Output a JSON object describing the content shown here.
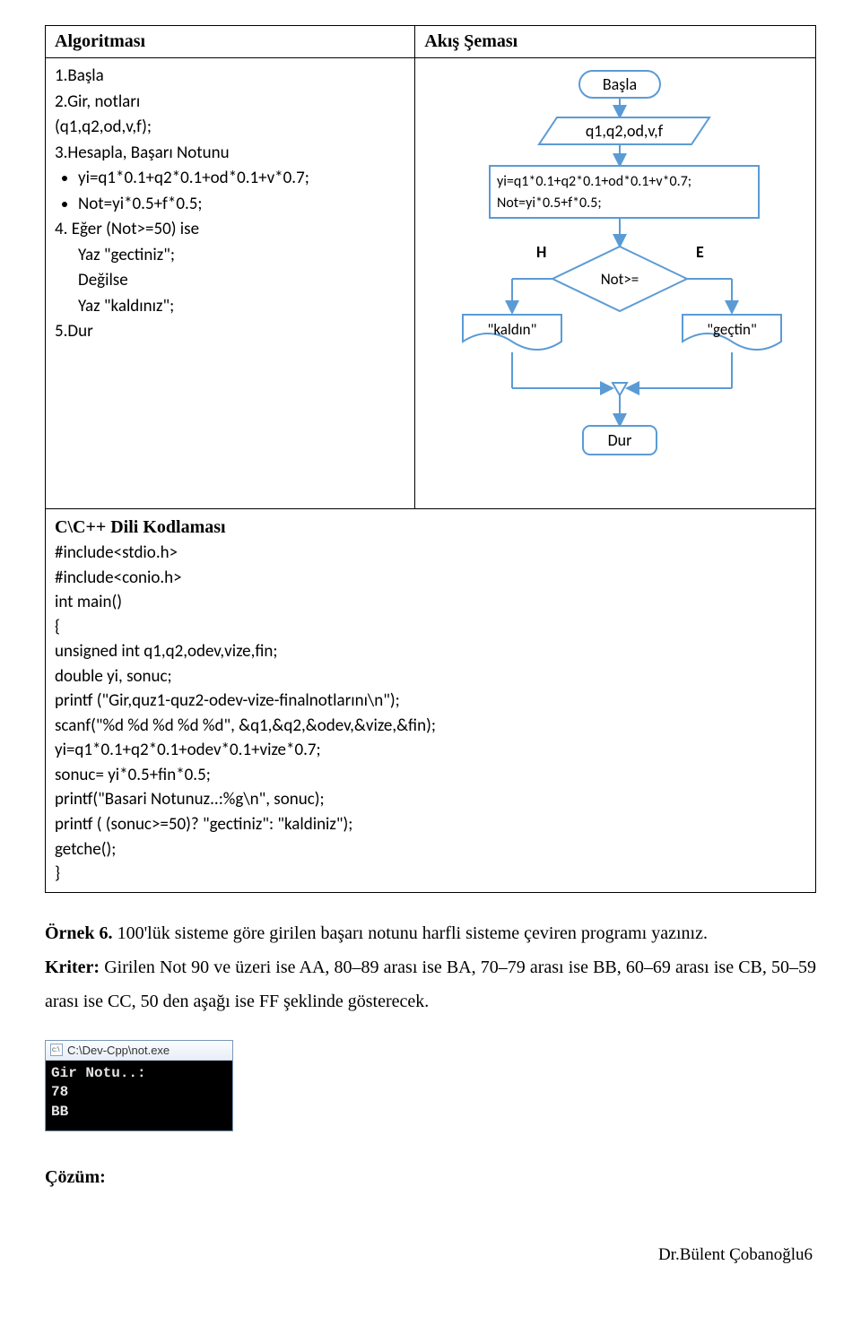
{
  "hdr_algo": "Algoritması",
  "hdr_flow": "Akış Şeması",
  "algo": {
    "l1": "1.Başla",
    "l2": "2.Gir, notları",
    "l2b": "(q1,q2,od,v,f);",
    "l3": "3.Hesapla, Başarı Notunu",
    "b1": "yi=q1*0.1+q2*0.1+od*0.1+v*0.7;",
    "b2": "Not=yi*0.5+f*0.5;",
    "l4": "4. Eğer (Not>=50) ise",
    "s1": "Yaz \"gectiniz\";",
    "s2": "Değilse",
    "s3": "Yaz \"kaldınız\";",
    "l5": "5.Dur"
  },
  "flow": {
    "start": "Başla",
    "input": "q1,q2,od,v,f",
    "proc1": "yi=q1*0.1+q2*0.1+od*0.1+v*0.7;",
    "proc2": "Not=yi*0.5+f*0.5;",
    "cond": "Not>=",
    "left": "H",
    "right": "E",
    "out_left": "\"kaldın\"",
    "out_right": "\"geçtin\"",
    "end": "Dur"
  },
  "code": {
    "title": "C\\C++ Dili Kodlaması",
    "l1": "#include<stdio.h>",
    "l2": "#include<conio.h>",
    "l3": "int main()",
    "l4": "{",
    "l5": "unsigned int q1,q2,odev,vize,fin;",
    "l6": "double yi, sonuc;",
    "l7": "printf (\"Gir,quz1-quz2-odev-vize-finalnotlarını\\n\");",
    "l8": "scanf(\"%d %d %d %d %d\", &q1,&q2,&odev,&vize,&fin);",
    "l9": "yi=q1*0.1+q2*0.1+odev*0.1+vize*0.7;",
    "l10": "sonuc= yi*0.5+fin*0.5;",
    "l11": "printf(\"Basari Notunuz..:%g\\n\", sonuc);",
    "l12": "printf ( (sonuc>=50)? \"gectiniz\": \"kaldiniz\");",
    "l13": "getche();",
    "l14": "}"
  },
  "body": {
    "ornek_label": "Örnek 6.",
    "ornek_text": " 100'lük sisteme göre girilen başarı notunu harfli sisteme çeviren programı yazınız.",
    "kriter_label": "Kriter:",
    "kriter_text": " Girilen Not 90 ve üzeri ise AA, 80–89 arası ise BA, 70–79 arası ise BB, 60–69 arası ise CB, 50–59 arası ise CC, 50 den aşağı ise FF şeklinde gösterecek."
  },
  "exe": {
    "title": "C:\\Dev-Cpp\\not.exe",
    "body": "Gir Notu..:\n78\nBB"
  },
  "cozum": "Çözüm:",
  "footer": "Dr.Bülent Çobanoğlu6"
}
